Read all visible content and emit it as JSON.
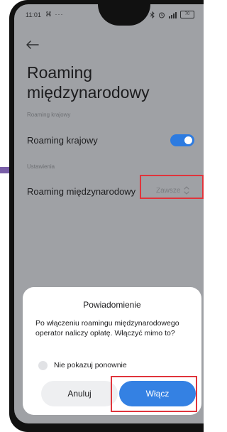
{
  "colors": {
    "accent": "#3481e3",
    "toggle_on": "#2d7be0",
    "highlight": "#e0343b",
    "dimmed_background": "#9fa1a5",
    "side_marker": "#7a5fa8"
  },
  "status_bar": {
    "time": "11:01",
    "left_icons": "⌘ ···",
    "battery": "70",
    "icons": [
      "navigation-icon",
      "bluetooth-icon",
      "alarm-icon",
      "signal-icon",
      "battery-icon"
    ]
  },
  "header": {
    "back_icon": "back-arrow-icon",
    "title": "Roaming międzynarodowy"
  },
  "sections": {
    "domestic": {
      "header": "Roaming krajowy",
      "item_label": "Roaming krajowy",
      "toggle_on": true
    },
    "settings": {
      "header": "Ustawienia",
      "item_label": "Roaming międzynarodowy",
      "value": "Zawsze",
      "chevron_icon": "up-down-chevron-icon"
    }
  },
  "dialog": {
    "title": "Powiadomienie",
    "message": "Po włączeniu roamingu międzynarodowego operator naliczy opłatę. Włączyć mimo to?",
    "checkbox_label": "Nie pokazuj ponownie",
    "checkbox_checked": false,
    "cancel_label": "Anuluj",
    "confirm_label": "Włącz"
  }
}
